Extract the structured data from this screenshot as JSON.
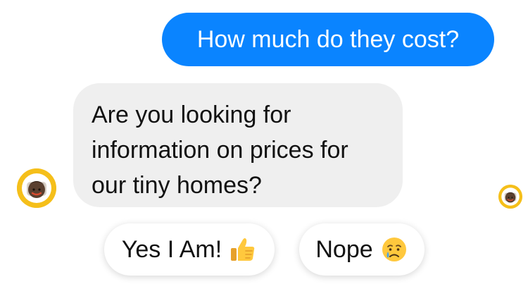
{
  "chat": {
    "outgoing_message": "How much do they cost?",
    "incoming_message_lines": [
      "Are you looking for",
      "information on prices for",
      "our tiny homes?"
    ]
  },
  "quick_replies": [
    {
      "label": "Yes I Am!",
      "icon": "thumbs-up-icon"
    },
    {
      "label": "Nope",
      "icon": "crying-face-icon"
    }
  ],
  "colors": {
    "outgoing_bubble": "#0a84ff",
    "incoming_bubble": "#efefef",
    "avatar_background": "#f5bf1a"
  },
  "avatars": {
    "bot_avatar": "bot-avatar-icon",
    "read_receipt_avatar": "read-receipt-avatar-icon"
  }
}
